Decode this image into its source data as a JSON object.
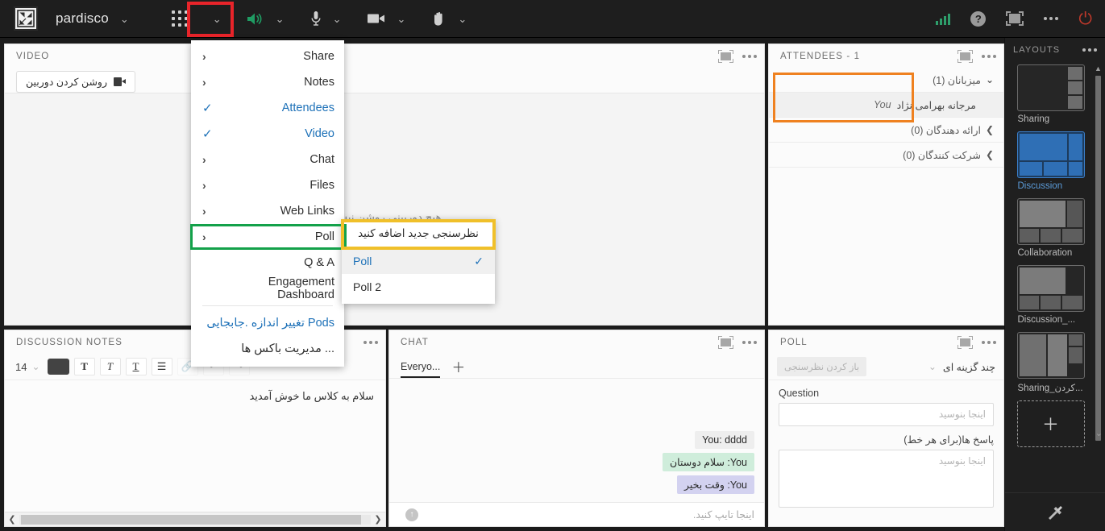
{
  "topbar": {
    "logo_icon": "pardisco-logo-icon",
    "room_name": "pardisco",
    "room_chevron": "chevron-down-icon",
    "pods_icon": "grid-apps-icon",
    "pods_chevron": "chevron-down-icon",
    "speaker_icon": "speaker-on-icon",
    "speaker_chevron": "chevron-down-icon",
    "mic_icon": "microphone-icon",
    "mic_chevron": "chevron-down-icon",
    "camera_icon": "camera-icon",
    "camera_chevron": "chevron-down-icon",
    "hand_icon": "raise-hand-icon",
    "hand_chevron": "chevron-down-icon",
    "connection_icon": "signal-bars-icon",
    "help_icon": "help-question-icon",
    "fullscreen_icon": "fullscreen-icon",
    "more_icon": "more-options-icon",
    "power_icon": "power-end-session-icon",
    "power_glyph": "⏻"
  },
  "pods_menu": {
    "items": [
      {
        "label": "Share",
        "lead": "›",
        "style": "plain"
      },
      {
        "label": "Notes",
        "lead": "›",
        "style": "plain"
      },
      {
        "label": "Attendees",
        "lead": "✓",
        "style": "checked"
      },
      {
        "label": "Video",
        "lead": "✓",
        "style": "checked"
      },
      {
        "label": "Chat",
        "lead": "›",
        "style": "plain"
      },
      {
        "label": "Files",
        "lead": "›",
        "style": "plain"
      },
      {
        "label": "Web Links",
        "lead": "›",
        "style": "plain"
      },
      {
        "label": "Poll",
        "lead": "›",
        "style": "plain"
      },
      {
        "label": "Q & A",
        "lead": "",
        "style": "plain"
      },
      {
        "label": "Engagement Dashboard",
        "lead": "",
        "style": "plain"
      }
    ],
    "footer_items": [
      {
        "label": "تغییر اندازه .جابجایی Pods",
        "style": "link"
      },
      {
        "label": "مدیریت باکس ها ...",
        "style": "plain"
      }
    ],
    "highlight_red_target": "pods-grid-button",
    "highlight_green_target": "menu-item-poll"
  },
  "poll_submenu": {
    "add_new_label": "نظرسنجی جدید اضافه کنید",
    "items": [
      {
        "label": "Poll",
        "checked": true
      },
      {
        "label": "Poll 2",
        "checked": false
      }
    ],
    "check_glyph": "✓"
  },
  "video_pod": {
    "title": "VIDEO",
    "start_camera_label": "روشن کردن دوربین",
    "empty_text": "هیچ دوربینی روشن نیست",
    "fullscreen_icon": "fullscreen-icon",
    "more_icon": "more-options-icon"
  },
  "attendees_pod": {
    "title": "ATTENDEES  - 1",
    "fullscreen_icon": "fullscreen-icon",
    "more_icon": "more-options-icon",
    "groups": [
      {
        "label": "میزبانان (1)",
        "arrow": "⌄",
        "expanded": true
      },
      {
        "label": "ارائه دهندگان (0)",
        "arrow": "❯",
        "expanded": false
      },
      {
        "label": "شرکت کنندگان (0)",
        "arrow": "❯",
        "expanded": false
      }
    ],
    "host_name": "مرجانه بهرامی نژاد",
    "host_you_label": "You"
  },
  "notes_pod": {
    "title": "DISCUSSION NOTES",
    "more_icon": "more-options-icon",
    "font_size": "14",
    "font_size_chevron": "chevron-down-icon",
    "color_swatch": "#434343",
    "buttons": [
      {
        "name": "bold-button",
        "glyph": "T",
        "dim": false
      },
      {
        "name": "italic-button",
        "glyph": "T",
        "dim": false
      },
      {
        "name": "underline-button",
        "glyph": "T",
        "dim": false
      },
      {
        "name": "bullet-list-button",
        "glyph": "☰",
        "dim": false
      },
      {
        "name": "link-button",
        "glyph": "🔗",
        "dim": true
      },
      {
        "name": "undo-button",
        "glyph": "↶",
        "dim": true
      },
      {
        "name": "redo-button",
        "glyph": "↷",
        "dim": true
      }
    ],
    "content": "سلام به کلاس ما خوش آمدید",
    "scroll_left_icon": "chevron-left-icon",
    "scroll_right_icon": "chevron-right-icon"
  },
  "chat_pod": {
    "title": "CHAT",
    "fullscreen_icon": "fullscreen-icon",
    "more_icon": "more-options-icon",
    "tab_label": "Everyo...",
    "add_tab_icon": "plus-icon",
    "messages": [
      {
        "text": "You: dddd",
        "tone": "gray"
      },
      {
        "text": "You: سلام دوستان",
        "tone": "green"
      },
      {
        "text": "You: وقت بخیر",
        "tone": "purple"
      }
    ],
    "input_placeholder": "اینجا تایپ کنید.",
    "send_icon": "send-up-icon"
  },
  "poll_pod": {
    "title": "POLL",
    "fullscreen_icon": "fullscreen-icon",
    "more_icon": "more-options-icon",
    "type_label": "چند گزینه ای",
    "type_chevron": "chevron-down-icon",
    "open_poll_label": "باز کردن نظرسنجی",
    "question_label": "Question",
    "question_placeholder": "اینجا بنوسید",
    "answers_label": "پاسخ ها(برای هر خط)",
    "answers_placeholder": "اینجا بنوسید"
  },
  "layouts_rail": {
    "title": "LAYOUTS",
    "more_icon": "more-options-icon",
    "scroll_up_icon": "chevron-up-icon",
    "scroll_down_icon": "chevron-down-icon",
    "add_layout_icon": "plus-icon",
    "preferences_icon": "tools-hammer-icon",
    "items": [
      {
        "label": "Sharing",
        "selected": false
      },
      {
        "label": "Discussion",
        "selected": true
      },
      {
        "label": "Collaboration",
        "selected": false
      },
      {
        "label": "Discussion_...",
        "selected": false
      },
      {
        "label": "Sharing_کردن...",
        "selected": false
      }
    ]
  }
}
